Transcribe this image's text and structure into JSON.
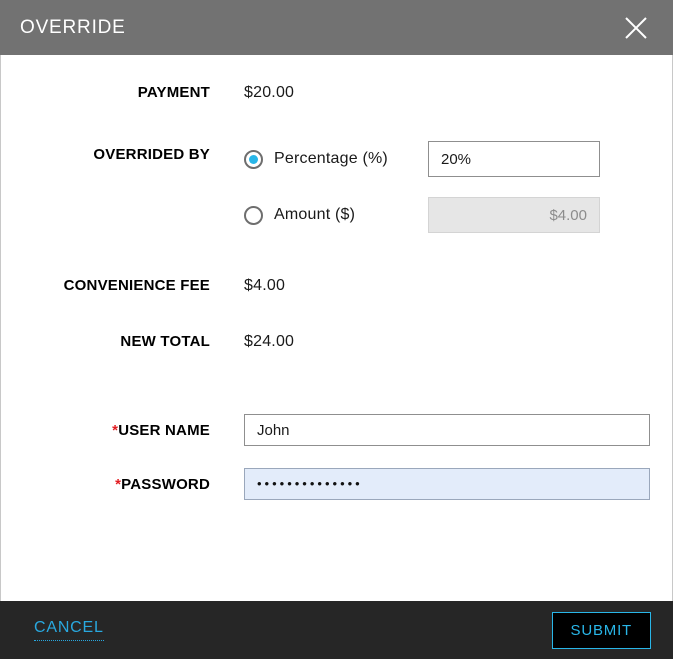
{
  "header": {
    "title": "OVERRIDE",
    "close_icon": "close-icon"
  },
  "form": {
    "payment": {
      "label": "PAYMENT",
      "value": "$20.00"
    },
    "overridden_by": {
      "label": "OVERRIDED BY",
      "options": [
        {
          "label": "Percentage (%)",
          "selected": true,
          "input_value": "20%",
          "disabled": false
        },
        {
          "label": "Amount ($)",
          "selected": false,
          "input_value": "$4.00",
          "disabled": true
        }
      ]
    },
    "convenience_fee": {
      "label": "CONVENIENCE FEE",
      "value": "$4.00"
    },
    "new_total": {
      "label": "NEW TOTAL",
      "value": "$24.00"
    },
    "user_name": {
      "required_marker": "*",
      "label": "USER NAME",
      "value": "John",
      "placeholder": ""
    },
    "password": {
      "required_marker": "*",
      "label": "PASSWORD",
      "value": "••••••••••••••",
      "placeholder": ""
    }
  },
  "footer": {
    "cancel_label": "CANCEL",
    "submit_label": "SUBMIT"
  },
  "colors": {
    "header_bg": "#727272",
    "footer_bg": "#262626",
    "accent": "#29b6e8",
    "link": "#29a8df",
    "required": "#e21c21",
    "disabled_bg": "#e6e6e6",
    "autofill_bg": "#e3ecfa"
  }
}
